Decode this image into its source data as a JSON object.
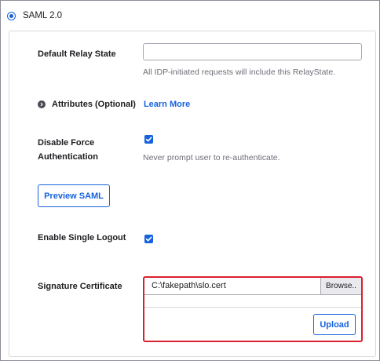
{
  "auth_option": {
    "label": "SAML 2.0",
    "selected": true
  },
  "fields": {
    "relay_state": {
      "label": "Default Relay State",
      "value": "",
      "help": "All IDP-initiated requests will include this RelayState."
    },
    "attributes": {
      "label": "Attributes (Optional)",
      "link": "Learn More"
    },
    "force_auth": {
      "label_line1": "Disable Force",
      "label_line2": "Authentication",
      "checked": true,
      "help": "Never prompt user to re-authenticate."
    },
    "preview": {
      "label": "Preview SAML"
    },
    "single_logout": {
      "label": "Enable Single Logout",
      "checked": true
    },
    "signature_cert": {
      "label": "Signature Certificate",
      "file_value": "C:\\fakepath\\slo.cert",
      "browse_label": "Browse..",
      "upload_label": "Upload"
    }
  },
  "colors": {
    "accent": "#1662dd",
    "error_border": "#d9202d"
  },
  "icons": [
    "radio-selected-icon",
    "chevron-right-icon",
    "checkmark-icon"
  ]
}
